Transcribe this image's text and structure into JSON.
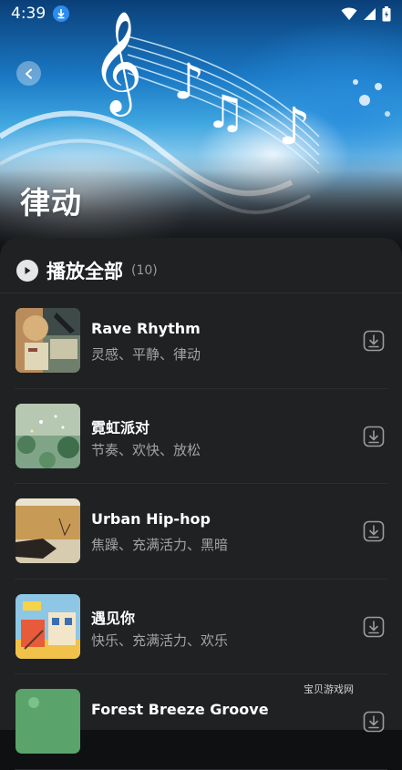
{
  "status_bar": {
    "time": "4:39"
  },
  "header": {
    "title": "律动"
  },
  "play_all": {
    "label": "播放全部",
    "count": "(10)"
  },
  "songs": [
    {
      "title": "Rave Rhythm",
      "tags": "灵感、平静、律动"
    },
    {
      "title": "霓虹派对",
      "tags": "节奏、欢快、放松"
    },
    {
      "title": "Urban Hip-hop",
      "tags": "焦躁、充满活力、黑暗"
    },
    {
      "title": "遇见你",
      "tags": "快乐、充满活力、欢乐"
    },
    {
      "title": "Forest Breeze Groove",
      "tags": ""
    }
  ],
  "watermark": "宝贝游戏网",
  "colors": {
    "sheet": "#202123",
    "background": "#0f1012",
    "accent_badge": "#2b8df0",
    "tag_text": "#a3a3a6"
  },
  "icons": [
    "download-icon",
    "wifi-icon",
    "signal-icon",
    "battery-icon",
    "back-arrow-icon",
    "play-icon"
  ]
}
